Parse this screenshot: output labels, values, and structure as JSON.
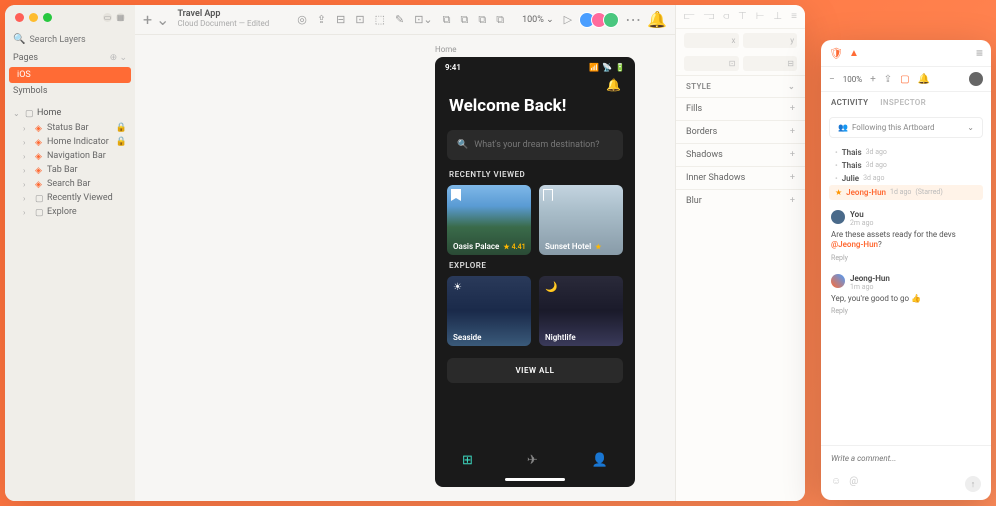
{
  "document": {
    "title": "Travel App",
    "subtitle": "Cloud Document — Edited"
  },
  "sidebar": {
    "search_placeholder": "Search Layers",
    "pages_label": "Pages",
    "pages": [
      {
        "name": "iOS",
        "active": true
      },
      {
        "name": "Symbols",
        "active": false
      }
    ],
    "root_layer": "Home",
    "layers": [
      "Status Bar",
      "Home Indicator",
      "Navigation Bar",
      "Tab Bar",
      "Search Bar",
      "Recently Viewed",
      "Explore"
    ]
  },
  "toolbar": {
    "zoom": "100%"
  },
  "artboard": {
    "label": "Home",
    "time": "9:41",
    "welcome": "Welcome Back!",
    "search_placeholder": "What's your dream destination?",
    "recently_viewed_label": "RECENTLY VIEWED",
    "explore_label": "EXPLORE",
    "view_all": "VIEW ALL",
    "cards_recent": [
      {
        "name": "Oasis Palace",
        "rating": "4.41"
      },
      {
        "name": "Sunset Hotel",
        "rating": ""
      }
    ],
    "cards_explore": [
      {
        "name": "Seaside"
      },
      {
        "name": "Nightlife"
      }
    ]
  },
  "inspector": {
    "style": "STYLE",
    "sections": [
      "Fills",
      "Borders",
      "Shadows",
      "Inner Shadows",
      "Blur"
    ]
  },
  "collab": {
    "zoom": "100%",
    "tabs": {
      "activity": "ACTIVITY",
      "inspector": "INSPECTOR"
    },
    "follow": "Following this Artboard",
    "activity": [
      {
        "name": "Thais",
        "time": "3d ago"
      },
      {
        "name": "Thais",
        "time": "3d ago"
      },
      {
        "name": "Julie",
        "time": "3d ago"
      }
    ],
    "starred": {
      "name": "Jeong-Hun",
      "time": "1d ago",
      "note": "(Starred)"
    },
    "comments": [
      {
        "author": "You",
        "time": "2m ago",
        "text_pre": "Are these assets ready for the devs ",
        "mention": "@Jeong-Hun",
        "text_post": "?",
        "reply": "Reply"
      },
      {
        "author": "Jeong-Hun",
        "time": "1m ago",
        "text_pre": "Yep, you're good to go 👍",
        "mention": "",
        "text_post": "",
        "reply": "Reply"
      }
    ],
    "input_placeholder": "Write a comment..."
  }
}
